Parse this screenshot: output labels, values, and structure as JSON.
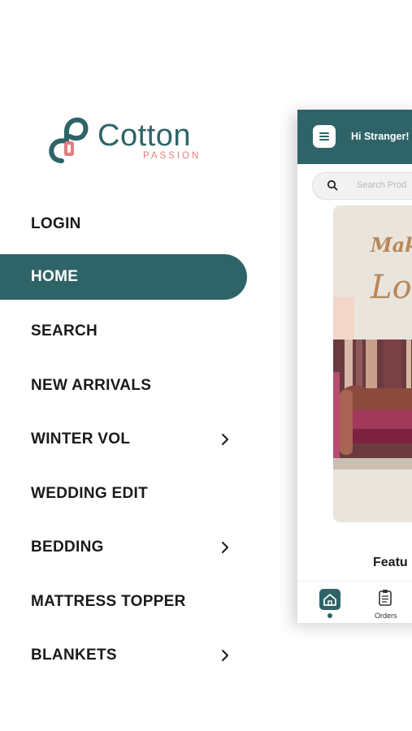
{
  "brand": {
    "name": "Cotton",
    "tagline": "PASSION",
    "primary_color": "#2e6468",
    "accent_color": "#e37c7c",
    "logo_icon": "cotton-passion-logo-icon"
  },
  "menu": {
    "items": [
      {
        "label": "LOGIN",
        "has_submenu": false,
        "active": false
      },
      {
        "label": "HOME",
        "has_submenu": false,
        "active": true
      },
      {
        "label": "SEARCH",
        "has_submenu": false,
        "active": false
      },
      {
        "label": "NEW ARRIVALS",
        "has_submenu": false,
        "active": false
      },
      {
        "label": "WINTER VOL",
        "has_submenu": true,
        "active": false
      },
      {
        "label": "WEDDING EDIT",
        "has_submenu": false,
        "active": false
      },
      {
        "label": "BEDDING",
        "has_submenu": true,
        "active": false
      },
      {
        "label": "MATTRESS TOPPER",
        "has_submenu": false,
        "active": false
      },
      {
        "label": "BLANKETS",
        "has_submenu": true,
        "active": false
      }
    ],
    "submenu_icon": "chevron-right-icon"
  },
  "preview": {
    "greeting": "Hi Stranger!",
    "menu_icon": "hamburger-menu-icon",
    "search_placeholder": "Search Prod",
    "search_icon": "search-icon",
    "banner_text_1": "Make",
    "banner_text_2": "Look",
    "section_title": "Featu",
    "bottom_nav": [
      {
        "label": "",
        "icon": "home-icon",
        "active": true
      },
      {
        "label": "Orders",
        "icon": "orders-clipboard-icon",
        "active": false
      }
    ]
  }
}
